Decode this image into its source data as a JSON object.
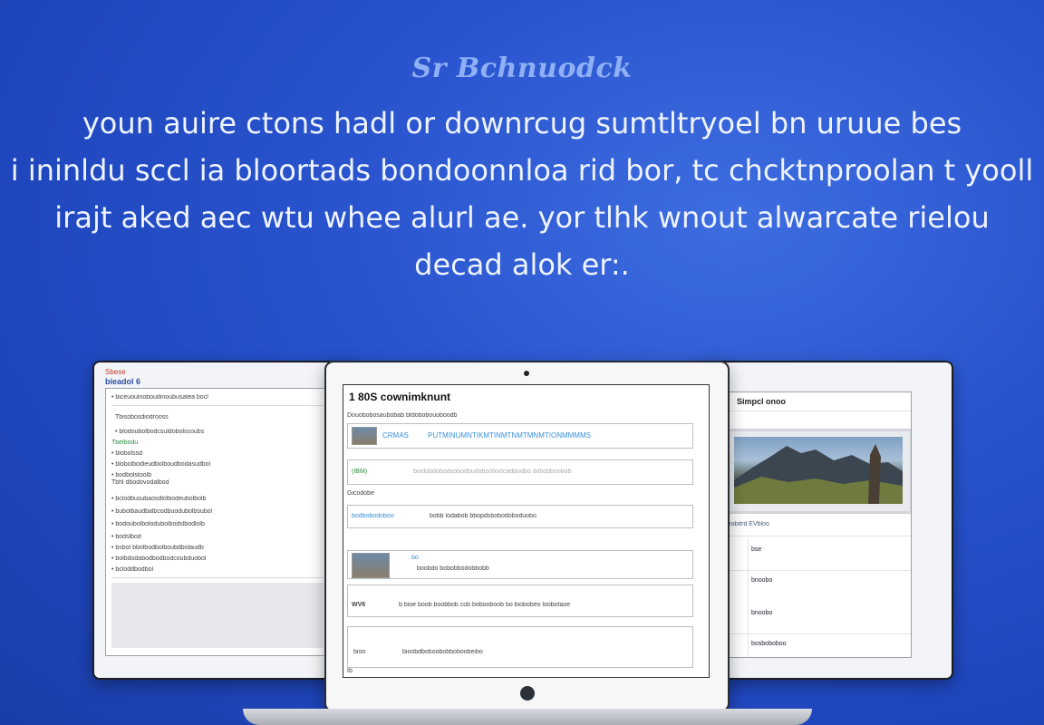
{
  "hero": {
    "title": "Sr Bchnuodck",
    "lines": [
      "youn auire ctons hadl or downrcug sumtltryoel bn uruue bes",
      "i ininldu sccl ia bloortads bondoonnloa rid bor, tc chcktnproolan t yooll",
      "irajt aked aec wtu whee alurl ae. yor tlhk wnout alwarcate rielou",
      "decad alok er:."
    ]
  },
  "left_tablet": {
    "header": "Sbese",
    "brand": "bieadol 6",
    "rows": [
      "• biceuoulnoboudinoubusatea bocl",
      "Tbisobosdiodrooss",
      "• blodoubolbodcsuldobolscoubs",
      "Tbelbodu",
      "• blobolssd",
      "• blobolbodleudbolboudbodasudbol",
      "• bodbolstoolb",
      "Tbhl   dbodovodalbod",
      "• bclodbusubaosdlolbodeubolbolb",
      "• bubolbaudbalbcodbuodubolbsubol",
      "• bodoubolbolodubolbodslbodlolb",
      "• bodslbod",
      "• bsbol bbolbodbolboubdbolaudb",
      "• bolbdodabodbodbodcoubduobol",
      "• bcloddbodbol"
    ]
  },
  "center_laptop": {
    "title": "1 80S cownimknunt",
    "subtitle": "Douobobosaubobab btdobobouoboodb",
    "cards": [
      {
        "label": "CRMAS",
        "link": "PUTMINUMNTIKMTINMTNMTMNMTIONMMMMS"
      },
      {
        "label": "(IBM)",
        "link": "biodobdobodoobodbudoboobodcadbodbo dobobboobob"
      },
      {
        "label": "bodbobodoboo",
        "link": "bobb lodabob bbopdsbobodoboduobo"
      },
      {
        "label": "bo",
        "link": "boobdo bobobbodobbobb"
      },
      {
        "label": "WV6",
        "link": "b bioe boob boobbob cob bobooboob bo biobobeo loobotaoe"
      },
      {
        "label": "bioo",
        "link": "bioobdboboobobboboobeibo"
      }
    ],
    "section_label": "Gicodobe",
    "footer": "Ib"
  },
  "right_tablet": {
    "title": "Simpcl onoo",
    "caption": "Al bibrabitrd EVbloo",
    "items": [
      "bse",
      "bnoobo",
      "bnoobo",
      "bosboboboo"
    ]
  }
}
